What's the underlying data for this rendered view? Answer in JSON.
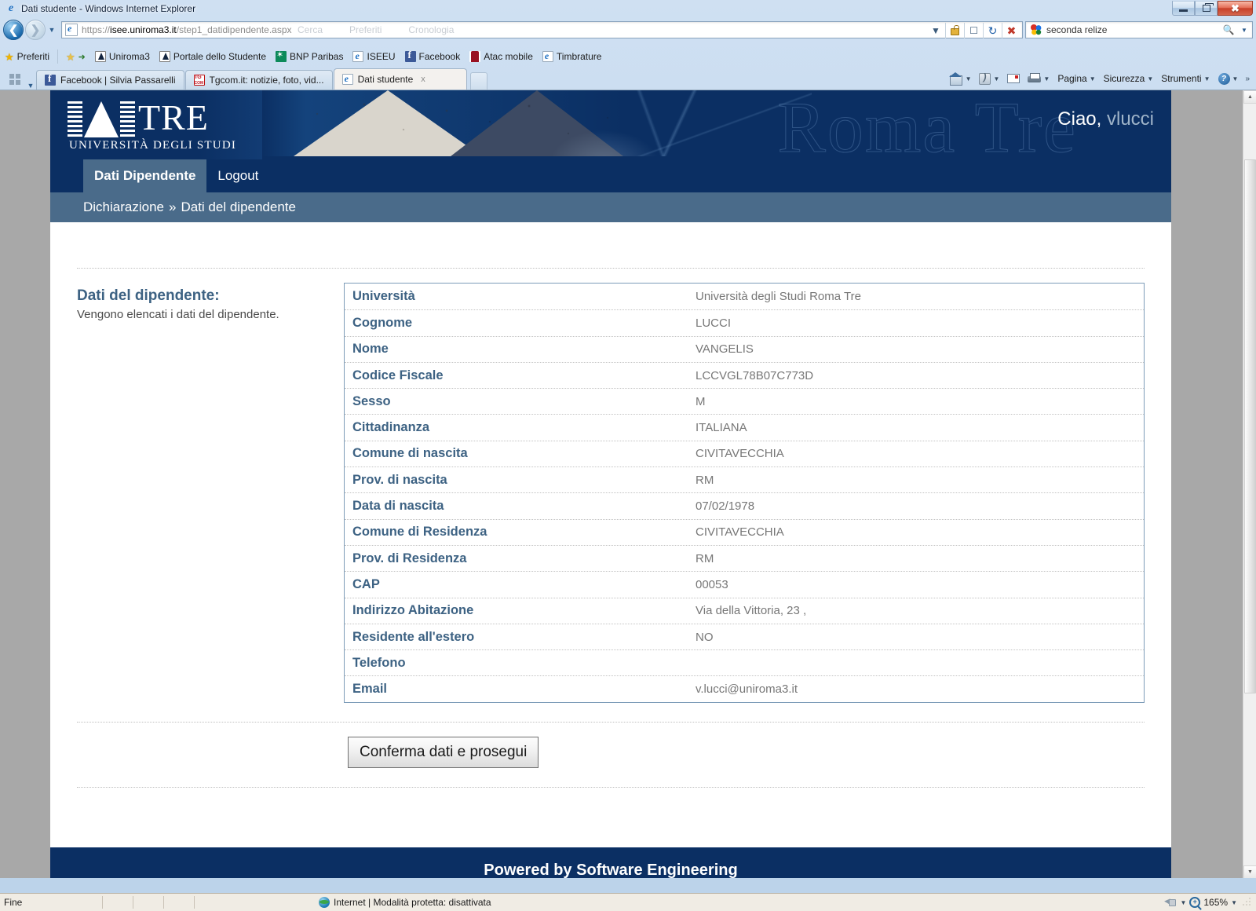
{
  "browser": {
    "window_title": "Dati studente - Windows Internet Explorer",
    "window_controls": {
      "minimize": "Riduci a icona",
      "restore": "Ripristina",
      "close": "Chiudi"
    },
    "address": {
      "scheme": "https://",
      "host": "isee.uniroma3.it",
      "path": "/step1_datidipendente.aspx",
      "suggestions": [
        "Cerca",
        "Preferiti",
        "Cronologia"
      ]
    },
    "search": {
      "value": "seconda relize",
      "placeholder": "Cerca"
    },
    "favorites_bar": {
      "label": "Preferiti",
      "items": [
        {
          "label": "Uniroma3",
          "icon": "uniroma3-favicon"
        },
        {
          "label": "Portale dello Studente",
          "icon": "uniroma3-favicon"
        },
        {
          "label": "BNP Paribas",
          "icon": "bnp-favicon"
        },
        {
          "label": "ISEEU",
          "icon": "ie-favicon"
        },
        {
          "label": "Facebook",
          "icon": "facebook-favicon"
        },
        {
          "label": "Atac mobile",
          "icon": "atac-favicon"
        },
        {
          "label": "Timbrature",
          "icon": "ie-favicon"
        }
      ]
    },
    "tabs": [
      {
        "label": "Facebook | Silvia Passarelli",
        "icon": "facebook-favicon",
        "active": false
      },
      {
        "label": "Tgcom.it: notizie, foto, vid...",
        "icon": "tgcom-favicon",
        "active": false
      },
      {
        "label": "Dati studente",
        "icon": "ie-favicon",
        "active": true,
        "close": "x"
      }
    ],
    "command_bar": [
      {
        "label": "Pagina",
        "icon": "page-icon"
      },
      {
        "label": "Sicurezza",
        "icon": "security-icon"
      },
      {
        "label": "Strumenti",
        "icon": "tools-icon"
      }
    ],
    "command_overflow": "»",
    "status_bar": {
      "left": "Fine",
      "zone": "Internet | Modalità protetta: disattivata",
      "zoom": "165%"
    }
  },
  "site": {
    "logo": {
      "word": "TRE",
      "subtitle": "UNIVERSITÀ DEGLI STUDI"
    },
    "watermark": "Roma Tre",
    "greeting": {
      "hello": "Ciao,",
      "user": "vlucci"
    },
    "nav": [
      {
        "label": "Dati Dipendente",
        "active": true
      },
      {
        "label": "Logout",
        "active": false
      }
    ],
    "breadcrumb": {
      "root": "Dichiarazione",
      "separator": "»",
      "current": "Dati del dipendente"
    },
    "footer": "Powered by Software Engineering",
    "colors": {
      "header_blue": "#0b2f63",
      "nav_active": "#4a6b8a",
      "label_blue": "#3d6283",
      "value_gray": "#777777"
    }
  },
  "main": {
    "section_title": "Dati del dipendente:",
    "section_desc": "Vengono elencati i dati del dipendente.",
    "rows": [
      {
        "label": "Università",
        "value": "Università degli Studi Roma Tre"
      },
      {
        "label": "Cognome",
        "value": "LUCCI"
      },
      {
        "label": "Nome",
        "value": "VANGELIS"
      },
      {
        "label": "Codice Fiscale",
        "value": "LCCVGL78B07C773D"
      },
      {
        "label": "Sesso",
        "value": "M"
      },
      {
        "label": "Cittadinanza",
        "value": "ITALIANA"
      },
      {
        "label": "Comune di nascita",
        "value": "CIVITAVECCHIA"
      },
      {
        "label": "Prov. di nascita",
        "value": "RM"
      },
      {
        "label": "Data di nascita",
        "value": "07/02/1978"
      },
      {
        "label": "Comune di Residenza",
        "value": "CIVITAVECCHIA"
      },
      {
        "label": "Prov. di Residenza",
        "value": "RM"
      },
      {
        "label": "CAP",
        "value": "00053"
      },
      {
        "label": "Indirizzo Abitazione",
        "value": "Via della Vittoria, 23 ,"
      },
      {
        "label": "Residente all'estero",
        "value": "NO"
      },
      {
        "label": "Telefono",
        "value": ""
      },
      {
        "label": "Email",
        "value": "v.lucci@uniroma3.it"
      }
    ],
    "submit_label": "Conferma dati e prosegui"
  }
}
